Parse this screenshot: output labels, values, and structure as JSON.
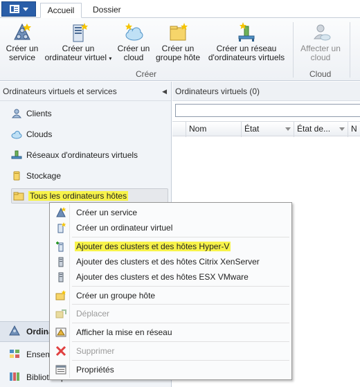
{
  "ribbon": {
    "tabs": [
      {
        "label": "Accueil"
      },
      {
        "label": "Dossier"
      }
    ],
    "buttons": [
      {
        "line1": "Créer un",
        "line2": "service",
        "icon": "create-service-icon"
      },
      {
        "line1": "Créer un",
        "line2": "ordinateur virtuel",
        "has_dropdown": true,
        "icon": "create-vm-icon"
      },
      {
        "line1": "Créer un",
        "line2": "cloud",
        "icon": "create-cloud-icon"
      },
      {
        "line1": "Créer un",
        "line2": "groupe hôte",
        "icon": "create-host-group-icon"
      },
      {
        "line1": "Créer un réseau",
        "line2": "d'ordinateurs virtuels",
        "icon": "create-vm-network-icon"
      },
      {
        "line1": "Affecter un",
        "line2": "cloud",
        "disabled": true,
        "icon": "assign-cloud-icon"
      }
    ],
    "groups": [
      {
        "label": "Créer"
      },
      {
        "label": "Cloud"
      }
    ]
  },
  "left_panel": {
    "title": "Ordinateurs virtuels et services",
    "tree": [
      {
        "label": "Clients",
        "icon": "clients-icon"
      },
      {
        "label": "Clouds",
        "icon": "cloud-icon"
      },
      {
        "label": "Réseaux d'ordinateurs virtuels",
        "icon": "vm-network-icon"
      },
      {
        "label": "Stockage",
        "icon": "storage-icon"
      },
      {
        "label": "Tous les ordinateurs hôtes",
        "icon": "host-folder-icon",
        "selected": true
      }
    ],
    "workspaces": [
      {
        "label": "Ordina",
        "icon": "vms-services-icon",
        "active": true
      },
      {
        "label": "Ensem",
        "icon": "fabric-icon"
      },
      {
        "label": "Bibliothèque",
        "icon": "library-icon"
      }
    ]
  },
  "right_panel": {
    "title": "Ordinateurs virtuels (0)",
    "search_value": "",
    "columns": [
      "Nom",
      "État",
      "État de...",
      "N"
    ]
  },
  "context_menu": {
    "items": [
      {
        "label": "Créer un service",
        "icon": "create-service-icon"
      },
      {
        "label": "Créer un ordinateur virtuel",
        "icon": "create-vm-icon"
      },
      {
        "label": "Ajouter des clusters et des hôtes Hyper-V",
        "icon": "add-hyperv-host-icon",
        "highlight": true
      },
      {
        "label": "Ajouter des clusters et des hôtes Citrix XenServer",
        "icon": "add-xenserver-host-icon"
      },
      {
        "label": "Ajouter des clusters et des hôtes ESX VMware",
        "icon": "add-esx-host-icon"
      },
      {
        "label": "Créer un groupe hôte",
        "icon": "create-host-group-icon"
      },
      {
        "label": "Déplacer",
        "icon": "move-icon",
        "disabled": true
      },
      {
        "label": "Afficher la mise en réseau",
        "icon": "view-networking-icon"
      },
      {
        "label": "Supprimer",
        "icon": "delete-icon",
        "disabled": true
      },
      {
        "label": "Propriétés",
        "icon": "properties-icon"
      }
    ]
  },
  "colors": {
    "highlight": "#f7f34a",
    "app_button": "#2a5ea8",
    "panel_bg": "#f1f4f8"
  }
}
